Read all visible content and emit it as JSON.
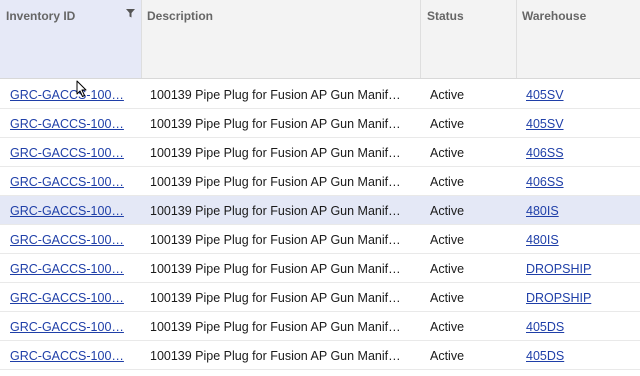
{
  "columns": {
    "inventory_id": "Inventory ID",
    "description": "Description",
    "status": "Status",
    "warehouse": "Warehouse"
  },
  "rows": [
    {
      "inventory_id": "GRC-GACCS-100…",
      "description": "100139 Pipe Plug for Fusion AP Gun Manif…",
      "status": "Active",
      "warehouse": "405SV"
    },
    {
      "inventory_id": "GRC-GACCS-100…",
      "description": "100139 Pipe Plug for Fusion AP Gun Manif…",
      "status": "Active",
      "warehouse": "405SV"
    },
    {
      "inventory_id": "GRC-GACCS-100…",
      "description": "100139 Pipe Plug for Fusion AP Gun Manif…",
      "status": "Active",
      "warehouse": "406SS"
    },
    {
      "inventory_id": "GRC-GACCS-100…",
      "description": "100139 Pipe Plug for Fusion AP Gun Manif…",
      "status": "Active",
      "warehouse": "406SS"
    },
    {
      "inventory_id": "GRC-GACCS-100…",
      "description": "100139 Pipe Plug for Fusion AP Gun Manif…",
      "status": "Active",
      "warehouse": "480IS"
    },
    {
      "inventory_id": "GRC-GACCS-100…",
      "description": "100139 Pipe Plug for Fusion AP Gun Manif…",
      "status": "Active",
      "warehouse": "480IS"
    },
    {
      "inventory_id": "GRC-GACCS-100…",
      "description": "100139 Pipe Plug for Fusion AP Gun Manif…",
      "status": "Active",
      "warehouse": "DROPSHIP"
    },
    {
      "inventory_id": "GRC-GACCS-100…",
      "description": "100139 Pipe Plug for Fusion AP Gun Manif…",
      "status": "Active",
      "warehouse": "DROPSHIP"
    },
    {
      "inventory_id": "GRC-GACCS-100…",
      "description": "100139 Pipe Plug for Fusion AP Gun Manif…",
      "status": "Active",
      "warehouse": "405DS"
    },
    {
      "inventory_id": "GRC-GACCS-100…",
      "description": "100139 Pipe Plug for Fusion AP Gun Manif…",
      "status": "Active",
      "warehouse": "405DS"
    }
  ],
  "selected_row": 4,
  "icons": {
    "filter": "filter-icon",
    "cursor": "mouse-cursor-icon"
  },
  "colors": {
    "link": "#1f3fa8",
    "selected_row": "#e4e8f6",
    "header_bg": "#f3f3f3"
  }
}
